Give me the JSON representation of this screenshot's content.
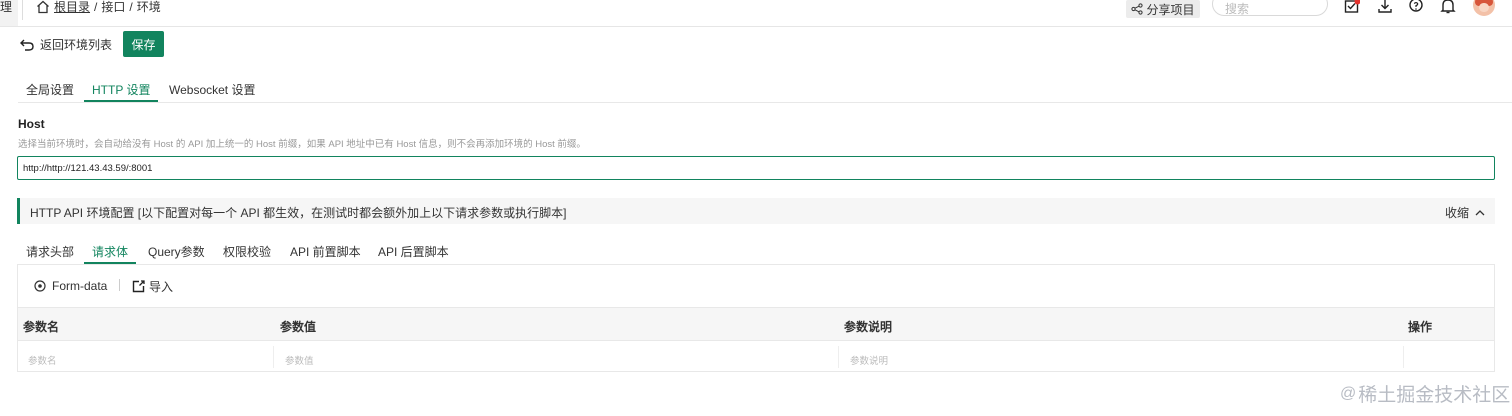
{
  "topbar": {
    "sidebar_stub_text": "理",
    "breadcrumb": {
      "root": "根目录",
      "sep1": "/",
      "item1": "接口",
      "sep2": "/",
      "item2": "环境"
    },
    "share_label": "分享项目",
    "search_placeholder": "搜索",
    "icons": [
      "home-icon",
      "share-icon",
      "checklist-icon",
      "download-icon",
      "help-icon",
      "bell-icon",
      "avatar"
    ],
    "notification_color": "#e5322d"
  },
  "actions": {
    "back_label": "返回环境列表",
    "save_label": "保存",
    "save_color": "#12845e"
  },
  "tabs": [
    {
      "label": "全局设置"
    },
    {
      "label": "HTTP 设置"
    },
    {
      "label": "Websocket 设置"
    }
  ],
  "active_tab": "HTTP 设置",
  "host": {
    "title": "Host",
    "description": "选择当前环境时，会自动给没有 Host 的 API 加上统一的 Host 前缀，如果 API 地址中已有 Host 信息，则不会再添加环境的 Host 前缀。",
    "value": "http://http://121.43.43.59/:8001"
  },
  "config": {
    "title": "HTTP API 环境配置 [以下配置对每一个 API 都生效，在测试时都会额外加上以下请求参数或执行脚本]",
    "collapse_label": "收缩"
  },
  "subtabs": [
    {
      "label": "请求头部"
    },
    {
      "label": "请求体"
    },
    {
      "label": "Query参数"
    },
    {
      "label": "权限校验"
    },
    {
      "label": "API 前置脚本"
    },
    {
      "label": "API 后置脚本"
    }
  ],
  "active_subtab": "请求体",
  "body": {
    "type_label": "Form-data",
    "import_label": "导入",
    "table": {
      "headers": [
        "参数名",
        "参数值",
        "参数说明",
        "操作"
      ],
      "placeholders": [
        "参数名",
        "参数值",
        "参数说明"
      ]
    }
  },
  "watermark": {
    "at": "@",
    "text": "稀土掘金技术社区"
  },
  "accent_color": "#12845e"
}
